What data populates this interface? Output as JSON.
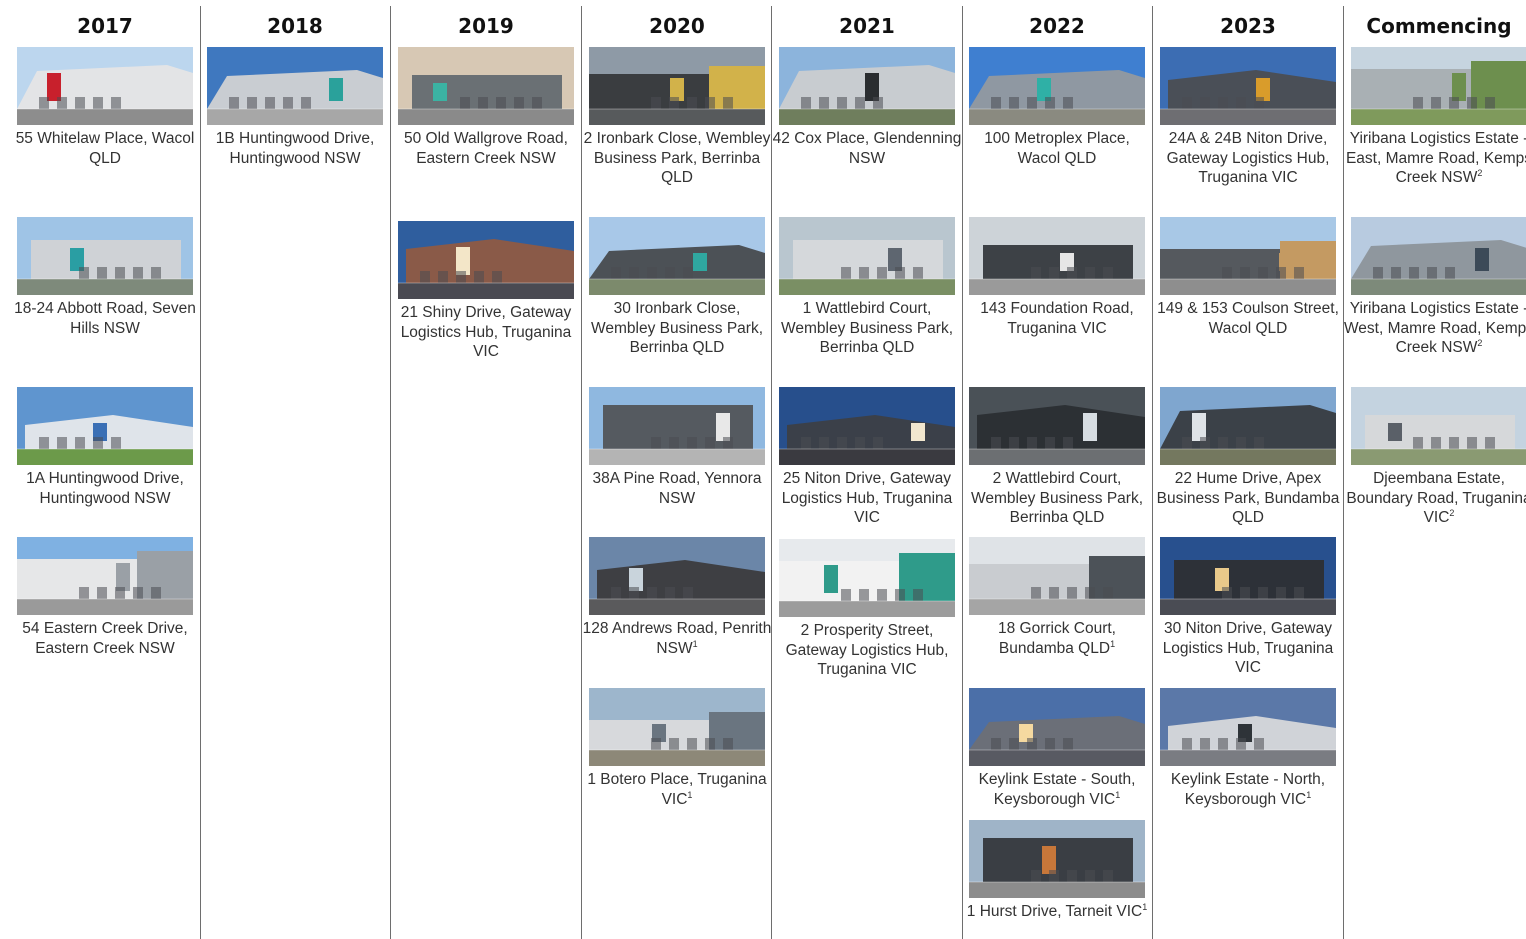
{
  "columns": [
    {
      "year": "2017",
      "items": [
        {
          "name": "55 Whitelaw Place, Wacol QLD",
          "sup": "",
          "photo": {
            "sky": "#bcd6ee",
            "wall": "#e3e4e6",
            "accent": "#c8202c",
            "ground": "#8d8d8d"
          }
        },
        {
          "name": "18-24 Abbott Road, Seven Hills NSW",
          "sup": "",
          "photo": {
            "sky": "#9fc4e6",
            "wall": "#cfd2d6",
            "accent": "#2a9ea3",
            "ground": "#7e8a7b"
          }
        },
        {
          "name": "1A Huntingwood Drive, Huntingwood NSW",
          "sup": "",
          "photo": {
            "sky": "#5f95cf",
            "wall": "#dfe4ea",
            "accent": "#3a6fb5",
            "ground": "#6c9a4a"
          }
        },
        {
          "name": "54 Eastern Creek Drive, Eastern Creek NSW",
          "sup": "",
          "photo": {
            "sky": "#7fb1e2",
            "wall": "#e6e7e8",
            "accent": "#9aa0a6",
            "ground": "#9a9a9a"
          }
        }
      ]
    },
    {
      "year": "2018",
      "items": [
        {
          "name": "1B Huntingwood Drive, Huntingwood NSW",
          "sup": "",
          "photo": {
            "sky": "#3f78bf",
            "wall": "#c9cdd2",
            "accent": "#2aa19b",
            "ground": "#a7a7a7"
          }
        }
      ]
    },
    {
      "year": "2019",
      "items": [
        {
          "name": "50 Old Wallgrove Road, Eastern Creek NSW",
          "sup": "",
          "photo": {
            "sky": "#d7c8b4",
            "wall": "#6a7074",
            "accent": "#3bb3a3",
            "ground": "#8a8a8a"
          }
        },
        {
          "name": "21 Shiny Drive, Gateway Logistics Hub, Truganina VIC",
          "sup": "",
          "photo": {
            "sky": "#2f5e9e",
            "wall": "#8a5a48",
            "accent": "#f3e6c8",
            "ground": "#4a4a52"
          }
        }
      ]
    },
    {
      "year": "2020",
      "items": [
        {
          "name": "2 Ironbark Close, Wembley Business Park, Berrinba QLD",
          "sup": "",
          "photo": {
            "sky": "#8e9aa6",
            "wall": "#3a3d40",
            "accent": "#d2b24a",
            "ground": "#575a5c"
          }
        },
        {
          "name": "30 Ironbark Close, Wembley Business Park, Berrinba QLD",
          "sup": "",
          "photo": {
            "sky": "#a8c8e8",
            "wall": "#4c5156",
            "accent": "#2fa7a0",
            "ground": "#7c8a6c"
          }
        },
        {
          "name": "38A Pine Road, Yennora NSW",
          "sup": "",
          "photo": {
            "sky": "#8fb8e0",
            "wall": "#555a60",
            "accent": "#e8e8e8",
            "ground": "#b4b4b4"
          }
        },
        {
          "name": "128 Andrews Road, Penrith NSW",
          "sup": "1",
          "photo": {
            "sky": "#6b86a8",
            "wall": "#3e3f43",
            "accent": "#c9d4dc",
            "ground": "#5a5a5c"
          }
        },
        {
          "name": "1 Botero Place, Truganina VIC",
          "sup": "1",
          "photo": {
            "sky": "#9db6cc",
            "wall": "#d7d9dc",
            "accent": "#6a7580",
            "ground": "#8d8878"
          }
        }
      ]
    },
    {
      "year": "2021",
      "items": [
        {
          "name": "42 Cox Place, Glendenning NSW",
          "sup": "",
          "photo": {
            "sky": "#8cb4dc",
            "wall": "#c8ccd0",
            "accent": "#2a2d30",
            "ground": "#6f7e5d"
          }
        },
        {
          "name": "1 Wattlebird Court, Wembley Business Park, Berrinba QLD",
          "sup": "",
          "photo": {
            "sky": "#b9c6cf",
            "wall": "#d5d8db",
            "accent": "#5e6670",
            "ground": "#7a8f64"
          }
        },
        {
          "name": "25 Niton Drive, Gateway Logistics Hub, Truganina VIC",
          "sup": "",
          "photo": {
            "sky": "#274f8c",
            "wall": "#3b4049",
            "accent": "#f2e7cf",
            "ground": "#3a3a40"
          }
        },
        {
          "name": "2 Prosperity Street, Gateway Logistics Hub, Truganina VIC",
          "sup": "",
          "photo": {
            "sky": "#e7eaed",
            "wall": "#f2f2f2",
            "accent": "#2f9b8a",
            "ground": "#9c9c9c"
          }
        }
      ]
    },
    {
      "year": "2022",
      "items": [
        {
          "name": "100 Metroplex Place, Wacol QLD",
          "sup": "",
          "photo": {
            "sky": "#3f7fd0",
            "wall": "#8f98a2",
            "accent": "#2fb0a6",
            "ground": "#8a8a80"
          }
        },
        {
          "name": "143 Foundation Road, Truganina VIC",
          "sup": "",
          "photo": {
            "sky": "#cdd3d8",
            "wall": "#3d4146",
            "accent": "#e6e6e6",
            "ground": "#9a9a9a"
          }
        },
        {
          "name": "2 Wattlebird Court, Wembley Business Park, Berrinba QLD",
          "sup": "",
          "photo": {
            "sky": "#4a5157",
            "wall": "#2c3034",
            "accent": "#d7dde2",
            "ground": "#6c6f72"
          }
        },
        {
          "name": "18 Gorrick Court, Bundamba QLD",
          "sup": "1",
          "photo": {
            "sky": "#dfe3e7",
            "wall": "#c9ccd0",
            "accent": "#4c5258",
            "ground": "#a5a5a5"
          }
        },
        {
          "name": "Keylink Estate - South, Keysborough VIC",
          "sup": "1",
          "photo": {
            "sky": "#4b6fa8",
            "wall": "#6b6f78",
            "accent": "#f5d9a0",
            "ground": "#585a62"
          }
        },
        {
          "name": "1 Hurst Drive, Tarneit VIC",
          "sup": "1",
          "photo": {
            "sky": "#9fb4c8",
            "wall": "#3a3e44",
            "accent": "#c7773a",
            "ground": "#8c8c8c"
          }
        }
      ]
    },
    {
      "year": "2023",
      "items": [
        {
          "name": "24A & 24B Niton Drive, Gateway Logistics Hub, Truganina VIC",
          "sup": "",
          "photo": {
            "sky": "#3c6db3",
            "wall": "#4a4f57",
            "accent": "#d99c2b",
            "ground": "#6e6e72"
          }
        },
        {
          "name": "149 & 153 Coulson Street, Wacol QLD",
          "sup": "",
          "photo": {
            "sky": "#a8c8e6",
            "wall": "#55595e",
            "accent": "#c49a62",
            "ground": "#8e8e8e"
          }
        },
        {
          "name": "22 Hume Drive, Apex Business Park, Bundamba QLD",
          "sup": "",
          "photo": {
            "sky": "#7fa6cf",
            "wall": "#3b4148",
            "accent": "#dfe3e7",
            "ground": "#74785f"
          }
        },
        {
          "name": "30 Niton Drive, Gateway Logistics Hub, Truganina VIC",
          "sup": "",
          "photo": {
            "sky": "#28508e",
            "wall": "#2d3138",
            "accent": "#e9c98a",
            "ground": "#4a4c54"
          }
        },
        {
          "name": "Keylink Estate - North, Keysborough VIC",
          "sup": "1",
          "photo": {
            "sky": "#5b78a8",
            "wall": "#d0d3d8",
            "accent": "#2e3338",
            "ground": "#7a7c82"
          }
        }
      ]
    },
    {
      "year": "Commencing",
      "items": [
        {
          "name": "Yiribana Logistics Estate - East, Mamre Road, Kemps Creek NSW",
          "sup": "2",
          "photo": {
            "sky": "#c6d4df",
            "wall": "#a9b0b4",
            "accent": "#6d8f4e",
            "ground": "#7f9a5c"
          }
        },
        {
          "name": "Yiribana Logistics Estate - West, Mamre Road, Kemps Creek NSW",
          "sup": "2",
          "photo": {
            "sky": "#b8cbe0",
            "wall": "#8f979e",
            "accent": "#3c4a58",
            "ground": "#7d8a7a"
          }
        },
        {
          "name": "Djeembana Estate, Boundary Road, Truganina VIC",
          "sup": "2",
          "photo": {
            "sky": "#c4d3e0",
            "wall": "#d6d8da",
            "accent": "#5a6068",
            "ground": "#8a9a72"
          }
        }
      ]
    }
  ]
}
